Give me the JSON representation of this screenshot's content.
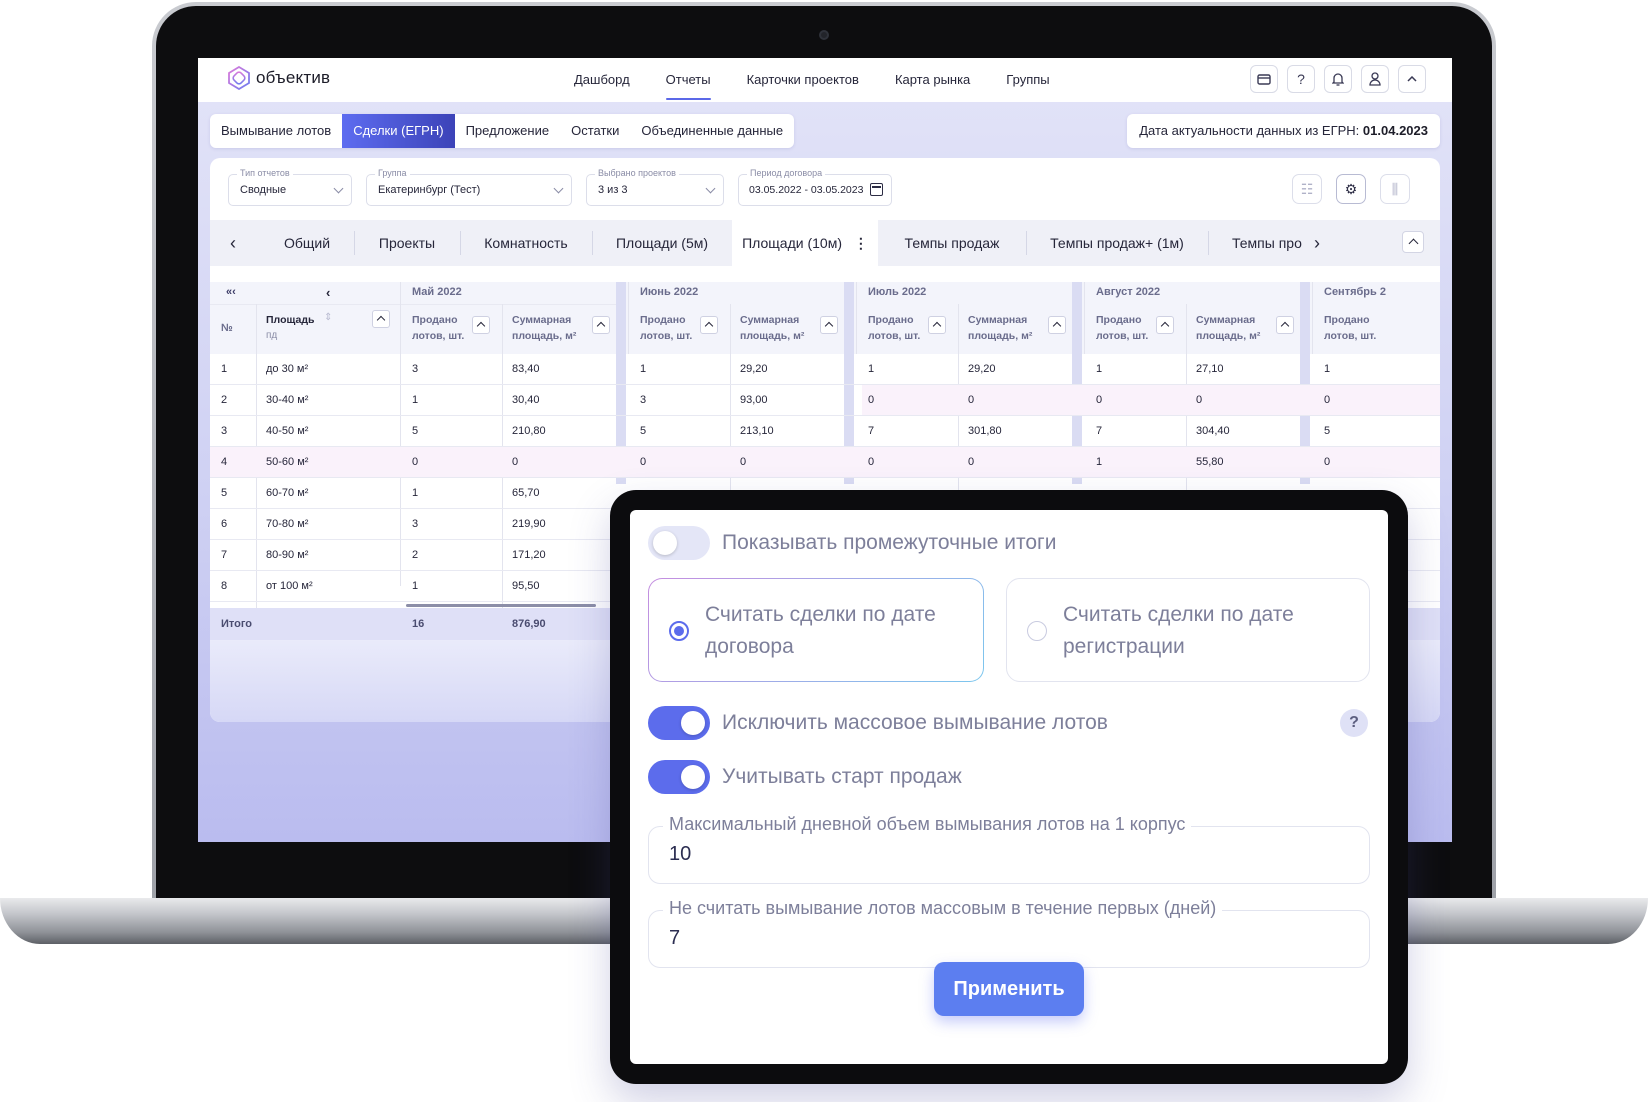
{
  "app": {
    "logo_text": "объектив"
  },
  "nav": [
    "Дашборд",
    "Отчеты",
    "Карточки проектов",
    "Карта рынка",
    "Группы"
  ],
  "top_icons": [
    "card-icon",
    "help-icon",
    "bell-icon",
    "user-icon",
    "chevron-up-icon"
  ],
  "report_tabs": [
    "Вымывание лотов",
    "Сделки (ЕГРН)",
    "Предложение",
    "Остатки",
    "Объединенные данные"
  ],
  "egrn": {
    "label": "Дата актуальности данных из ЕГРН:",
    "date": "01.04.2023"
  },
  "filters": {
    "report_type": {
      "label": "Тип отчетов",
      "value": "Сводные"
    },
    "group": {
      "label": "Группа",
      "value": "Екатеринбург (Тест)"
    },
    "projects": {
      "label": "Выбрано проектов",
      "value": "3 из 3"
    },
    "period": {
      "label": "Период договора",
      "value": "03.05.2022 - 03.05.2023"
    }
  },
  "subtabs": [
    "Общий",
    "Проекты",
    "Комнатность",
    "Площади (5м)",
    "Площади (10м)",
    "Темпы продаж",
    "Темпы продаж+ (1м)",
    "Темпы про"
  ],
  "table": {
    "nav_first": "«‹",
    "nav_prev": "‹",
    "col_no": "№",
    "col_area": "Площадь",
    "col_area_sub": "пд",
    "months": [
      "Май 2022",
      "Июнь 2022",
      "Июль 2022",
      "Август 2022",
      "Сентябрь 2"
    ],
    "col_sold": "Продано лотов, шт.",
    "col_total": "Суммарная площадь, м²",
    "rows": [
      {
        "n": "1",
        "area": "до 30 м²",
        "m": [
          [
            "3",
            "83,40"
          ],
          [
            "1",
            "29,20"
          ],
          [
            "1",
            "29,20"
          ],
          [
            "1",
            "27,10"
          ],
          [
            "1",
            ""
          ]
        ]
      },
      {
        "n": "2",
        "area": "30-40 м²",
        "m": [
          [
            "1",
            "30,40"
          ],
          [
            "3",
            "93,00"
          ],
          [
            "0",
            "0"
          ],
          [
            "0",
            "0"
          ],
          [
            "0",
            ""
          ]
        ]
      },
      {
        "n": "3",
        "area": "40-50 м²",
        "m": [
          [
            "5",
            "210,80"
          ],
          [
            "5",
            "213,10"
          ],
          [
            "7",
            "301,80"
          ],
          [
            "7",
            "304,40"
          ],
          [
            "5",
            ""
          ]
        ]
      },
      {
        "n": "4",
        "area": "50-60 м²",
        "m": [
          [
            "0",
            "0"
          ],
          [
            "0",
            "0"
          ],
          [
            "0",
            "0"
          ],
          [
            "1",
            "55,80"
          ],
          [
            "0",
            ""
          ]
        ]
      },
      {
        "n": "5",
        "area": "60-70 м²",
        "m": [
          [
            "1",
            "65,70"
          ]
        ]
      },
      {
        "n": "6",
        "area": "70-80 м²",
        "m": [
          [
            "3",
            "219,90"
          ]
        ]
      },
      {
        "n": "7",
        "area": "80-90 м²",
        "m": [
          [
            "2",
            "171,20"
          ]
        ]
      },
      {
        "n": "8",
        "area": "от 100 м²",
        "m": [
          [
            "1",
            "95,50"
          ]
        ]
      }
    ],
    "totals": {
      "label": "Итого",
      "sold": "16",
      "area": "876,90"
    }
  },
  "settings": {
    "show_subtotals": {
      "label": "Показывать промежуточные итоги",
      "on": false
    },
    "count_by_contract": "Считать сделки по дате договора",
    "count_by_registration": "Считать сделки по дате регистрации",
    "exclude_mass": {
      "label": "Исключить массовое вымывание лотов",
      "on": true
    },
    "help": "?",
    "sales_start": {
      "label": "Учитывать старт продаж",
      "on": true
    },
    "max_daily": {
      "label": "Максимальный дневной объем вымывания лотов на 1 корпус",
      "value": "10"
    },
    "first_days": {
      "label": "Не считать вымывание лотов массовым в течение первых (дней)",
      "value": "7"
    },
    "apply": "Применить"
  },
  "colors": {
    "accent": "#5c6cec",
    "tab_active_start": "#5d6cf0",
    "tab_active_end": "#3c43b8"
  }
}
